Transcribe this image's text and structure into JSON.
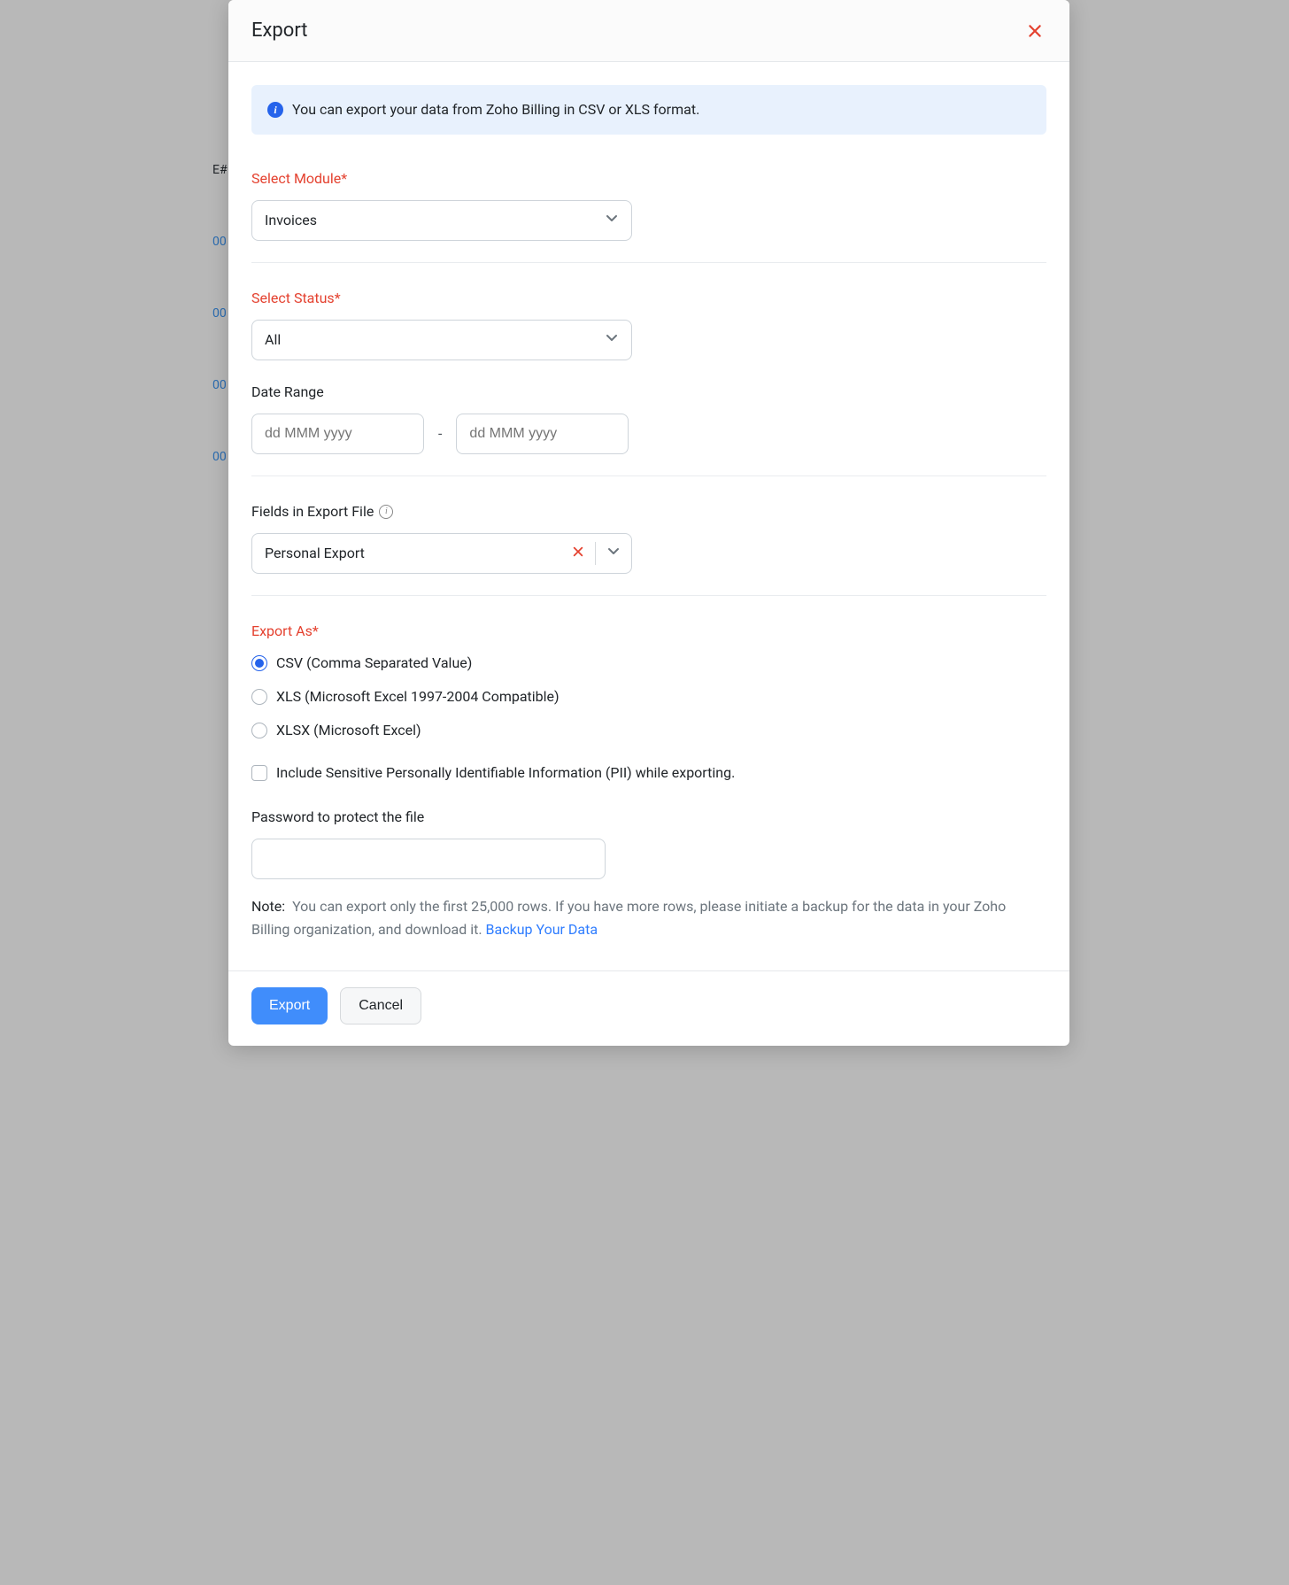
{
  "modal": {
    "title": "Export",
    "info_banner": "You can export your data from Zoho Billing in CSV or XLS format.",
    "select_module": {
      "label": "Select Module*",
      "value": "Invoices"
    },
    "select_status": {
      "label": "Select Status*",
      "value": "All"
    },
    "date_range": {
      "label": "Date Range",
      "from_placeholder": "dd MMM yyyy",
      "to_placeholder": "dd MMM yyyy",
      "sep": "-"
    },
    "fields_in_export": {
      "label": "Fields in Export File",
      "value": "Personal Export"
    },
    "export_as": {
      "label": "Export As*",
      "options": [
        {
          "value": "csv",
          "label": "CSV (Comma Separated Value)",
          "checked": true
        },
        {
          "value": "xls",
          "label": "XLS (Microsoft Excel 1997-2004 Compatible)",
          "checked": false
        },
        {
          "value": "xlsx",
          "label": "XLSX (Microsoft Excel)",
          "checked": false
        }
      ]
    },
    "pii_checkbox": {
      "label": "Include Sensitive Personally Identifiable Information (PII) while exporting.",
      "checked": false
    },
    "password": {
      "label": "Password to protect the file",
      "value": ""
    },
    "note": {
      "prefix": "Note:",
      "text": "You can export only the first 25,000 rows. If you have more rows, please initiate a backup for the data in your Zoho Billing organization, and download it.",
      "link_text": "Backup Your Data"
    },
    "buttons": {
      "primary": "Export",
      "secondary": "Cancel"
    }
  },
  "bg": {
    "h1": "E#",
    "r1": "00",
    "r2": "00",
    "r3": "00",
    "r4": "00"
  }
}
